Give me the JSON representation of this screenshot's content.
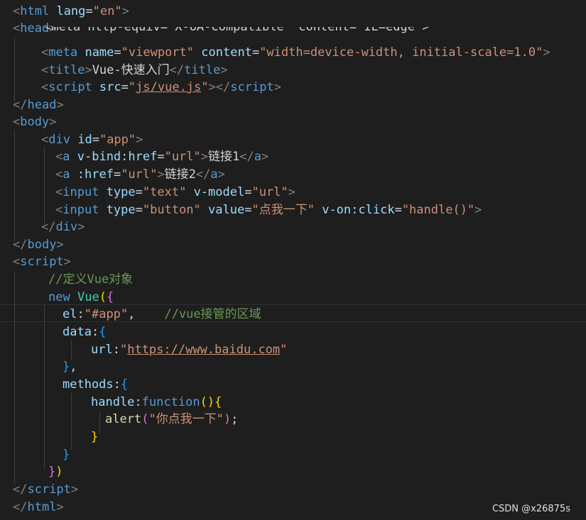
{
  "lines": {
    "l1": {
      "open": "<",
      "tag": "html",
      "attr": "lang",
      "eq": "=",
      "val": "\"en\"",
      "close": ">"
    },
    "l2": {
      "open": "<",
      "tag": "head",
      "close": ">"
    },
    "l3": {
      "text": "<meta http-equiv=\"X-UA-Compatible\" content=\"IE=edge\">"
    },
    "l4": {
      "open": "<",
      "tag": "meta",
      "attr1": "name",
      "eq1": "=",
      "val1": "\"viewport\"",
      "attr2": "content",
      "eq2": "=",
      "val2": "\"width=device-width, initial-scale=1.0\"",
      "close": ">"
    },
    "l5": {
      "open": "<",
      "tag": "title",
      "close": ">",
      "text": "Vue-快速入门",
      "end_open": "</",
      "end_tag": "title",
      "end_close": ">"
    },
    "l6": {
      "open": "<",
      "tag": "script",
      "attr": "src",
      "eq": "=",
      "q1": "\"",
      "val": "js/vue.js",
      "q2": "\"",
      "close": ">",
      "end_open": "</",
      "end_tag": "script",
      "end_close": ">"
    },
    "l7": {
      "open": "</",
      "tag": "head",
      "close": ">"
    },
    "l8": {
      "open": "<",
      "tag": "body",
      "close": ">"
    },
    "l9": {
      "open": "<",
      "tag": "div",
      "attr": "id",
      "eq": "=",
      "val": "\"app\"",
      "close": ">"
    },
    "l10": {
      "open": "<",
      "tag": "a",
      "attr": "v-bind:href",
      "eq": "=",
      "val": "\"url\"",
      "close": ">",
      "text": "链接1",
      "end_open": "</",
      "end_tag": "a",
      "end_close": ">"
    },
    "l11": {
      "open": "<",
      "tag": "a",
      "attr": ":href",
      "eq": "=",
      "val": "\"url\"",
      "close": ">",
      "text": "链接2",
      "end_open": "</",
      "end_tag": "a",
      "end_close": ">"
    },
    "l12": {
      "open": "<",
      "tag": "input",
      "attr1": "type",
      "eq1": "=",
      "val1": "\"text\"",
      "attr2": "v-model",
      "eq2": "=",
      "val2": "\"url\"",
      "close": ">"
    },
    "l13": {
      "open": "<",
      "tag": "input",
      "attr1": "type",
      "eq1": "=",
      "val1": "\"button\"",
      "attr2": "value",
      "eq2": "=",
      "val2": "\"点我一下\"",
      "attr3": "v-on:click",
      "eq3": "=",
      "val3": "\"handle()\"",
      "close": ">"
    },
    "l14": {
      "open": "</",
      "tag": "div",
      "close": ">"
    },
    "l15": {
      "open": "</",
      "tag": "body",
      "close": ">"
    },
    "l16": {
      "open": "<",
      "tag": "script",
      "close": ">"
    },
    "l17": {
      "comment": "//定义Vue对象"
    },
    "l18": {
      "kw": "new",
      "cls": "Vue",
      "paren": "(",
      "brace": "{"
    },
    "l19": {
      "prop": "el",
      "colon": ":",
      "val": "\"#app\"",
      "comma": ",",
      "comment": "//vue接管的区域"
    },
    "l20": {
      "prop": "data",
      "colon": ":",
      "brace": "{"
    },
    "l21": {
      "prop": "url",
      "colon": ":",
      "q1": "\"",
      "val": "https://www.baidu.com",
      "q2": "\""
    },
    "l22": {
      "brace": "}",
      "comma": ","
    },
    "l23": {
      "prop": "methods",
      "colon": ":",
      "brace": "{"
    },
    "l24": {
      "prop": "handle",
      "colon": ":",
      "kw": "function",
      "paren": "()",
      "brace": "{"
    },
    "l25": {
      "fn": "alert",
      "paren1": "(",
      "val": "\"你点我一下\"",
      "paren2": ")",
      "semi": ";"
    },
    "l26": {
      "brace": "}"
    },
    "l27": {
      "brace": "}"
    },
    "l28": {
      "brace": "}",
      "paren": ")"
    },
    "l29": {
      "open": "</",
      "tag": "script",
      "close": ">"
    },
    "l30": {
      "open": "</",
      "tag": "html",
      "close": ">"
    }
  },
  "watermark": "CSDN @x26875s"
}
